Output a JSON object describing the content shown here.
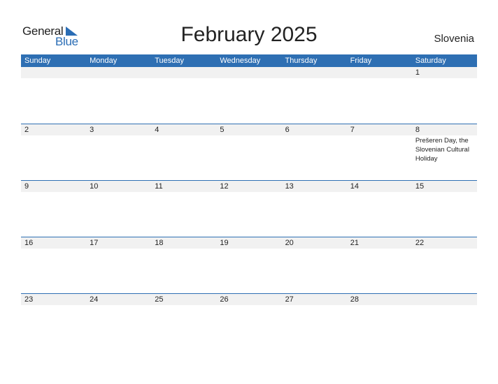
{
  "logo": {
    "general": "General",
    "blue": "Blue"
  },
  "title": "February 2025",
  "country": "Slovenia",
  "colors": {
    "header": "#2e6fb3",
    "date_band": "#f1f1f1",
    "logo_blue": "#2a6db5"
  },
  "weekdays": [
    "Sunday",
    "Monday",
    "Tuesday",
    "Wednesday",
    "Thursday",
    "Friday",
    "Saturday"
  ],
  "weeks": [
    [
      {
        "d": ""
      },
      {
        "d": ""
      },
      {
        "d": ""
      },
      {
        "d": ""
      },
      {
        "d": ""
      },
      {
        "d": ""
      },
      {
        "d": "1"
      }
    ],
    [
      {
        "d": "2"
      },
      {
        "d": "3"
      },
      {
        "d": "4"
      },
      {
        "d": "5"
      },
      {
        "d": "6"
      },
      {
        "d": "7"
      },
      {
        "d": "8",
        "event": "Prešeren Day, the Slovenian Cultural Holiday"
      }
    ],
    [
      {
        "d": "9"
      },
      {
        "d": "10"
      },
      {
        "d": "11"
      },
      {
        "d": "12"
      },
      {
        "d": "13"
      },
      {
        "d": "14"
      },
      {
        "d": "15"
      }
    ],
    [
      {
        "d": "16"
      },
      {
        "d": "17"
      },
      {
        "d": "18"
      },
      {
        "d": "19"
      },
      {
        "d": "20"
      },
      {
        "d": "21"
      },
      {
        "d": "22"
      }
    ],
    [
      {
        "d": "23"
      },
      {
        "d": "24"
      },
      {
        "d": "25"
      },
      {
        "d": "26"
      },
      {
        "d": "27"
      },
      {
        "d": "28"
      },
      {
        "d": ""
      }
    ]
  ]
}
